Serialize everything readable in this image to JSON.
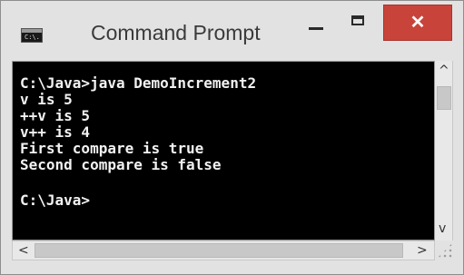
{
  "window": {
    "title": "Command Prompt",
    "icon_label": "C:\\.",
    "icons": {
      "app": "console-app-icon",
      "minimize": "minimize-icon",
      "maximize": "maximize-icon",
      "close": "close-icon",
      "up": "chevron-up-icon",
      "down": "chevron-down-icon",
      "left": "chevron-left-icon",
      "right": "chevron-right-icon"
    },
    "colors": {
      "close_button": "#c8443a",
      "console_background": "#000000",
      "console_text": "#f2f2f2"
    }
  },
  "console": {
    "lines": [
      "C:\\Java>java DemoIncrement2",
      "v is 5",
      "++v is 5",
      "v++ is 4",
      "First compare is true",
      "Second compare is false",
      "",
      "C:\\Java>"
    ]
  },
  "controls": {
    "close_symbol": "✕",
    "up_symbol": "^",
    "down_symbol": "v",
    "left_symbol": "<",
    "right_symbol": ">"
  }
}
